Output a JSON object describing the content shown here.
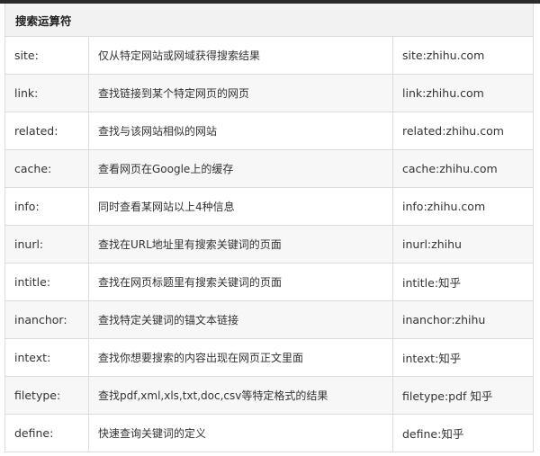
{
  "table": {
    "title": "搜索运算符",
    "rows": [
      {
        "op": "site:",
        "desc": "仅从特定网站或网域获得搜索结果",
        "example": "site:zhihu.com"
      },
      {
        "op": "link:",
        "desc": "查找链接到某个特定网页的网页",
        "example": "link:zhihu.com"
      },
      {
        "op": "related:",
        "desc": "查找与该网站相似的网站",
        "example": "related:zhihu.com"
      },
      {
        "op": "cache:",
        "desc": "查看网页在Google上的缓存",
        "example": "cache:zhihu.com"
      },
      {
        "op": "info:",
        "desc": "同时查看某网站以上4种信息",
        "example": "info:zhihu.com"
      },
      {
        "op": "inurl:",
        "desc": "查找在URL地址里有搜索关键词的页面",
        "example": "inurl:zhihu"
      },
      {
        "op": "intitle:",
        "desc": "查找在网页标题里有搜索关键词的页面",
        "example": "intitle:知乎"
      },
      {
        "op": "inanchor:",
        "desc": "查找特定关键词的锚文本链接",
        "example": "inanchor:zhihu"
      },
      {
        "op": "intext:",
        "desc": "查找你想要搜索的内容出现在网页正文里面",
        "example": "intext:知乎"
      },
      {
        "op": "filetype:",
        "desc": "查找pdf,xml,xls,txt,doc,csv等特定格式的结果",
        "example": "filetype:pdf 知乎"
      },
      {
        "op": "define:",
        "desc": "快速查询关键词的定义",
        "example": "define:知乎"
      }
    ]
  },
  "colors": {
    "header_bg": "#f2f2f2",
    "border": "#dcdcdc",
    "top_bar": "#2b2b2b"
  }
}
